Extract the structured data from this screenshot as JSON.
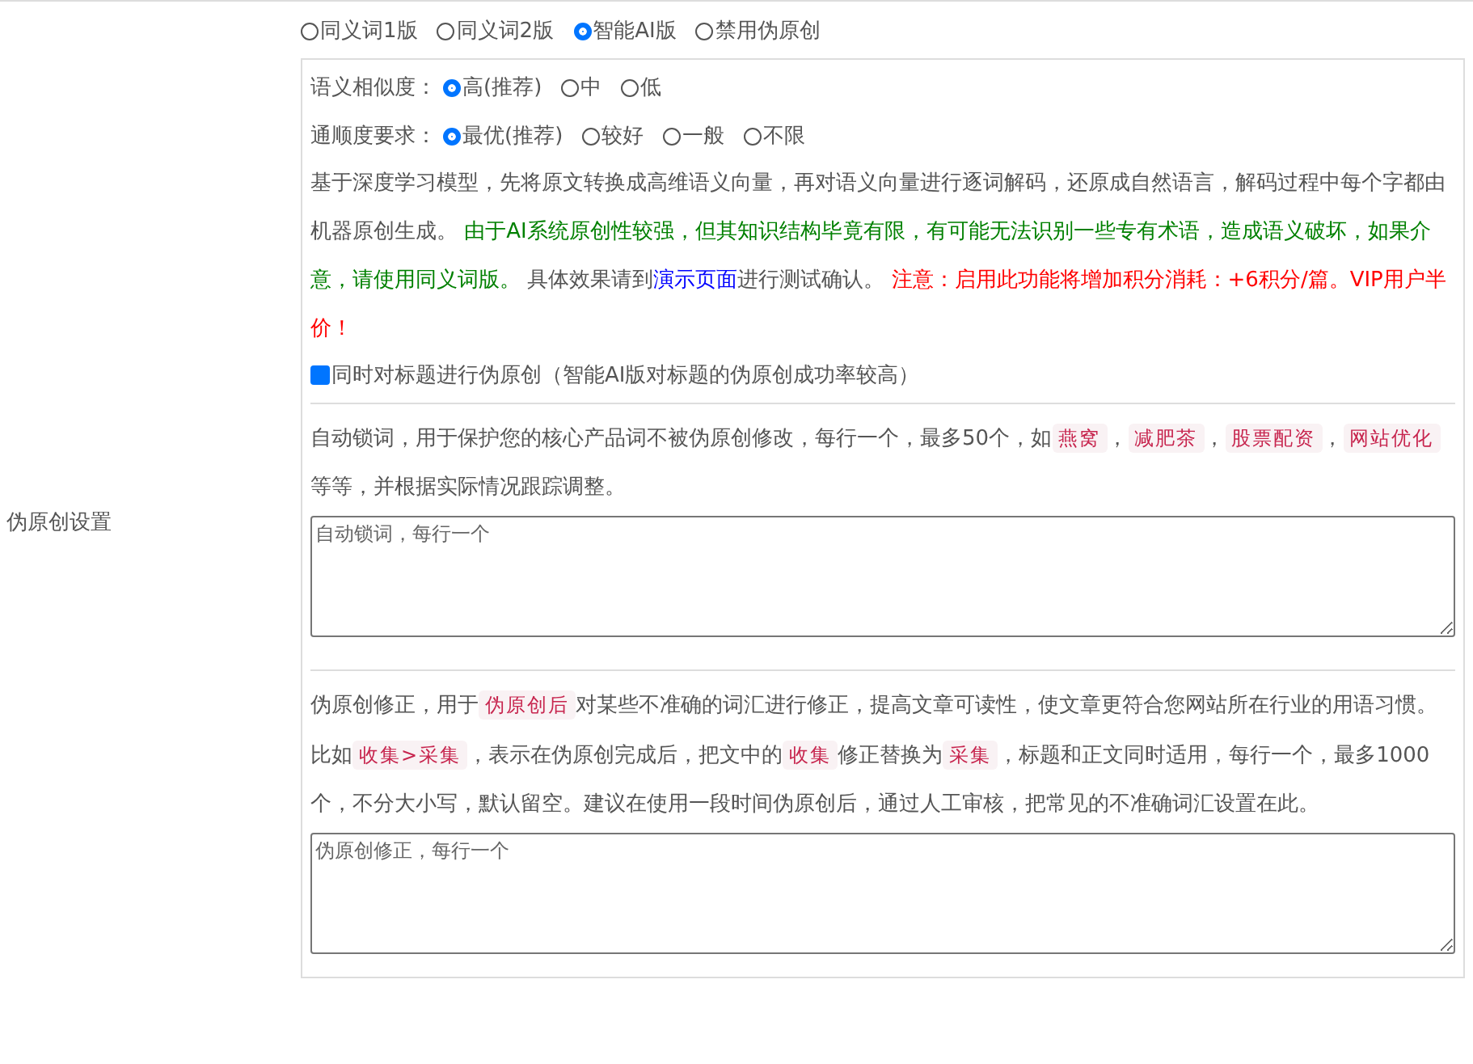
{
  "mode_options": [
    {
      "label": "同义词1版",
      "selected": false
    },
    {
      "label": "同义词2版",
      "selected": false
    },
    {
      "label": "智能AI版",
      "selected": true
    },
    {
      "label": "禁用伪原创",
      "selected": false
    }
  ],
  "ai_settings": {
    "similarity": {
      "label": "语义相似度：",
      "options": [
        {
          "label": "高(推荐)",
          "selected": true
        },
        {
          "label": "中",
          "selected": false
        },
        {
          "label": "低",
          "selected": false
        }
      ]
    },
    "fluency": {
      "label": "通顺度要求：",
      "options": [
        {
          "label": "最优(推荐)",
          "selected": true
        },
        {
          "label": "较好",
          "selected": false
        },
        {
          "label": "一般",
          "selected": false
        },
        {
          "label": "不限",
          "selected": false
        }
      ]
    },
    "description": [
      {
        "kind": "text",
        "text": "基于深度学习模型，先将原文转换成高维语义向量，再对语义向量进行逐词解码，还原成自然语言，解码过程中每个字都由机器原创生成。 "
      },
      {
        "kind": "note",
        "text": "由于AI系统原创性较强，但其知识结构毕竟有限，有可能无法识别一些专有术语，造成语义破坏，如果介意，请使用同义词版。"
      },
      {
        "kind": "text",
        "text": " 具体效果请到"
      },
      {
        "kind": "link",
        "text": "演示页面"
      },
      {
        "kind": "text",
        "text": "进行测试确认。 "
      },
      {
        "kind": "warning",
        "text": "注意：启用此功能将增加积分消耗：+6积分/篇。VIP用户半价！"
      }
    ],
    "title_option": {
      "label": "同时对标题进行伪原创（智能AI版对标题的伪原创成功率较高）",
      "checked": true
    }
  },
  "section_label": "伪原创设置",
  "lock_words": {
    "description": [
      {
        "kind": "text",
        "text": "自动锁词，用于保护您的核心产品词不被伪原创修改，每行一个，最多50个，如"
      },
      {
        "kind": "code",
        "text": "燕窝"
      },
      {
        "kind": "text",
        "text": "，"
      },
      {
        "kind": "code",
        "text": "减肥茶"
      },
      {
        "kind": "text",
        "text": "，"
      },
      {
        "kind": "code",
        "text": "股票配资"
      },
      {
        "kind": "text",
        "text": "，"
      },
      {
        "kind": "code",
        "text": "网站优化"
      },
      {
        "kind": "text",
        "text": " 等等，并根据实际情况跟踪调整。"
      }
    ],
    "placeholder": "自动锁词，每行一个"
  },
  "correction": {
    "description": [
      {
        "kind": "text",
        "text": "伪原创修正，用于"
      },
      {
        "kind": "code",
        "text": "伪原创后"
      },
      {
        "kind": "text",
        "text": "对某些不准确的词汇进行修正，提高文章可读性，使文章更符合您网站所在行业的用语习惯。比如"
      },
      {
        "kind": "code",
        "text": "收集>采集"
      },
      {
        "kind": "text",
        "text": "，表示在伪原创完成后，把文中的"
      },
      {
        "kind": "code",
        "text": "收集"
      },
      {
        "kind": "text",
        "text": "修正替换为"
      },
      {
        "kind": "code",
        "text": "采集"
      },
      {
        "kind": "text",
        "text": "，标题和正文同时适用，每行一个，最多1000个，不分大小写，默认留空。建议在使用一段时间伪原创后，通过人工审核，把常见的不准确词汇设置在此。"
      }
    ],
    "placeholder": "伪原创修正，每行一个"
  }
}
